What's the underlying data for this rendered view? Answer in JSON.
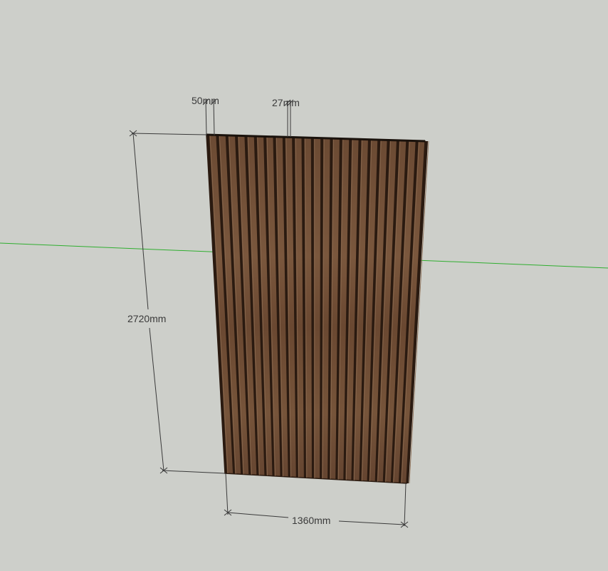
{
  "colors": {
    "background": "#cdcfca",
    "axis_green": "#2fae2f",
    "wood_dark": "#4a2e1c",
    "wood_mid": "#6b4a33",
    "wood_light": "#7e5c42",
    "dimension_line": "#3a3a3a"
  },
  "dimensions": {
    "slat_width": "50mm",
    "gap_width": "27mm",
    "height": "2720mm",
    "width": "1360mm"
  },
  "panel": {
    "slat_count": 23
  }
}
